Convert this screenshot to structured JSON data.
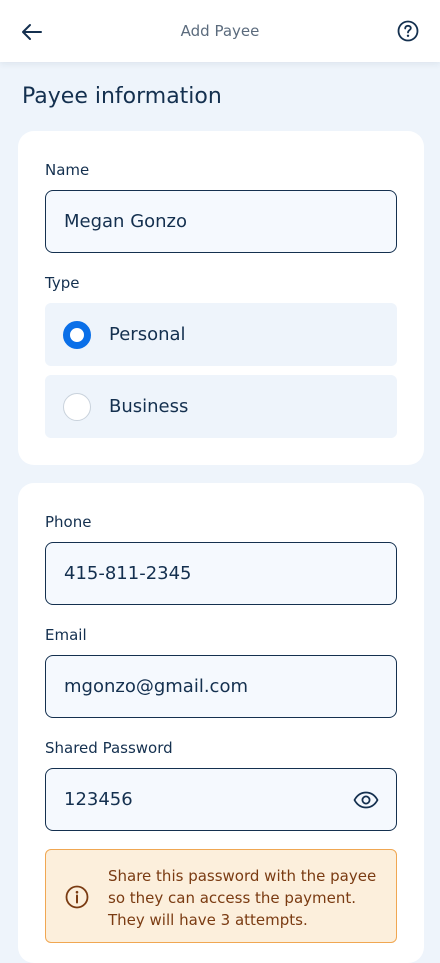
{
  "header": {
    "title": "Add Payee",
    "back_icon": "arrow-left-icon",
    "help_icon": "question-circle-icon"
  },
  "section": {
    "title": "Payee information"
  },
  "payee": {
    "name_label": "Name",
    "name_value": "Megan Gonzo",
    "type_label": "Type",
    "type_options": [
      {
        "label": "Personal",
        "selected": true
      },
      {
        "label": "Business",
        "selected": false
      }
    ]
  },
  "contact": {
    "phone_label": "Phone",
    "phone_value": "415-811-2345",
    "email_label": "Email",
    "email_value": "mgonzo@gmail.com",
    "password_label": "Shared Password",
    "password_value": "123456",
    "password_toggle_icon": "eye-icon"
  },
  "notice": {
    "icon": "info-icon",
    "text": "Share this password with the payee so they can access the payment. They will have 3 attempts."
  },
  "colors": {
    "accent": "#0a6fe8",
    "text": "#14304f",
    "background": "#eef4fb",
    "notice_bg": "#fcefdc",
    "notice_border": "#f0a752",
    "notice_text": "#7a3b12"
  }
}
